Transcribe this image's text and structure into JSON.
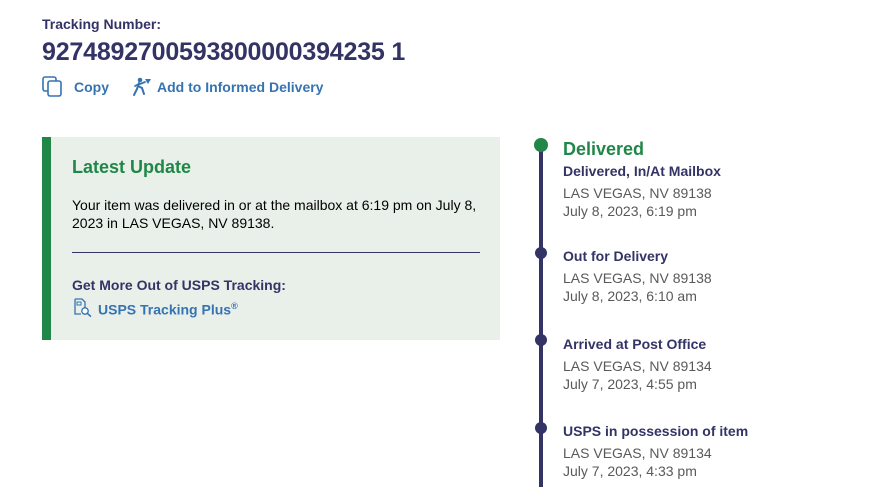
{
  "tracking": {
    "label": "Tracking Number:",
    "number": "9274892700593800000394235 1"
  },
  "actions": {
    "copy_label": "Copy",
    "informed_delivery_label": "Add to Informed Delivery"
  },
  "latest_update": {
    "title": "Latest Update",
    "text": "Your item was delivered in or at the mailbox at 6:19 pm on July 8, 2023 in LAS VEGAS, NV 89138.",
    "more_label": "Get More Out of USPS Tracking:",
    "plus_link_label": "USPS Tracking Plus",
    "plus_link_mark": "®"
  },
  "timeline": {
    "current_status": "Delivered",
    "events": [
      {
        "status": "Delivered, In/At Mailbox",
        "location": "LAS VEGAS, NV 89138",
        "time": "July 8, 2023, 6:19 pm"
      },
      {
        "status": "Out for Delivery",
        "location": "LAS VEGAS, NV 89138",
        "time": "July 8, 2023, 6:10 am"
      },
      {
        "status": "Arrived at Post Office",
        "location": "LAS VEGAS, NV 89134",
        "time": "July 7, 2023, 4:55 pm"
      },
      {
        "status": "USPS in possession of item",
        "location": "LAS VEGAS, NV 89134",
        "time": "July 7, 2023, 4:33 pm"
      }
    ]
  },
  "colors": {
    "navy": "#333366",
    "green": "#218748",
    "link_blue": "#3573b1",
    "card_bg": "#e9f0e9",
    "gray_text": "#595959"
  },
  "icons": [
    "copy-icon",
    "informed-delivery-icon",
    "tracking-plus-icon"
  ]
}
